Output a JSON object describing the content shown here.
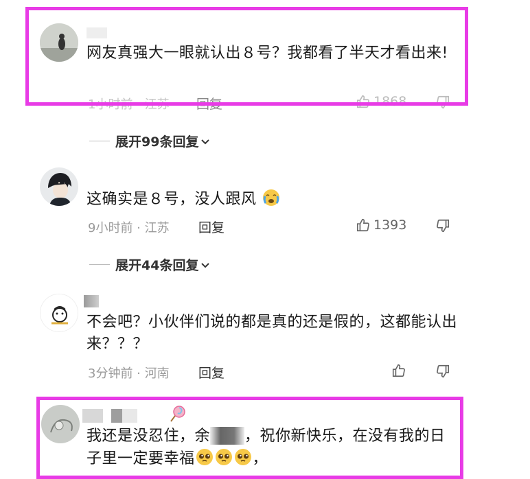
{
  "comments": [
    {
      "text": "网友真强大一眼就认出８号？我都看了半天才看出来!",
      "meta": "1小时前 · 江苏",
      "reply_label": "回复",
      "likes": "1868",
      "expand": "展开99条回复"
    },
    {
      "text": "这确实是８号，没人跟风",
      "meta": "9小时前 · 江苏",
      "reply_label": "回复",
      "likes": "1393",
      "expand": "展开44条回复"
    },
    {
      "text": "不会吧？小伙伴们说的都是真的还是假的，这都能认出来？？？",
      "meta": "3分钟前 · 河南",
      "reply_label": "回复",
      "likes": ""
    },
    {
      "text_part1": "我还是没忍住，余",
      "text_part2": "，祝你新快乐，在没有我的日子里一定要幸福",
      "text_part3": "，"
    }
  ],
  "colors": {
    "highlight": "#e83be6",
    "meta": "#9a9a9a"
  },
  "icons": [
    "thumbs-up-icon",
    "thumbs-down-icon",
    "chevron-down-icon",
    "crying-emoji-icon",
    "pleading-emoji-icon",
    "lollipop-icon"
  ]
}
